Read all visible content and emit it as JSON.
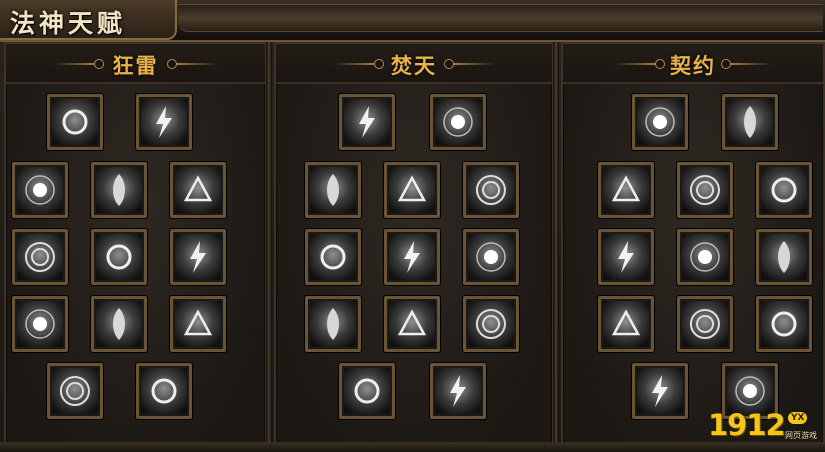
{
  "window": {
    "title": "法神天赋"
  },
  "columns": [
    {
      "title": "狂雷",
      "icons": [
        "hands-orb-icon",
        "lightning-fist-icon",
        "dark-ring-icon",
        "lightning-strike-icon",
        "mage-face-icon",
        "staff-icon",
        "rune-circle-icon",
        "bearded-mage-icon",
        "rune-wheel-icon",
        "light-burst-icon",
        "rune-wheel-2-icon",
        "stone-sigil-icon",
        "stone-emblem-icon"
      ]
    },
    {
      "title": "焚天",
      "icons": [
        "crystal-shard-icon",
        "arch-mage-icon",
        "orb-caster-icon",
        "hooded-mage-icon",
        "spiral-icon",
        "orb-ring-icon",
        "hamsa-hand-icon",
        "arcane-sigil-icon",
        "palm-hand-icon",
        "open-hands-icon",
        "light-ray-icon",
        "reaching-hand-icon",
        "glowing-hand-icon"
      ]
    },
    {
      "title": "契约",
      "icons": [
        "light-beam-icon",
        "spirit-mist-icon",
        "storm-cloud-icon",
        "lightning-hand-icon",
        "storm-figure-icon",
        "thunderbolt-icon",
        "energy-orb-icon",
        "warning-rune-icon",
        "lightning-tree-icon",
        "claw-strike-icon",
        "flame-icon",
        "ghost-flame-icon",
        "dragon-emblem-icon"
      ]
    }
  ],
  "watermark": {
    "number": "1912",
    "badge": "YX",
    "subtitle": "网页游戏"
  }
}
